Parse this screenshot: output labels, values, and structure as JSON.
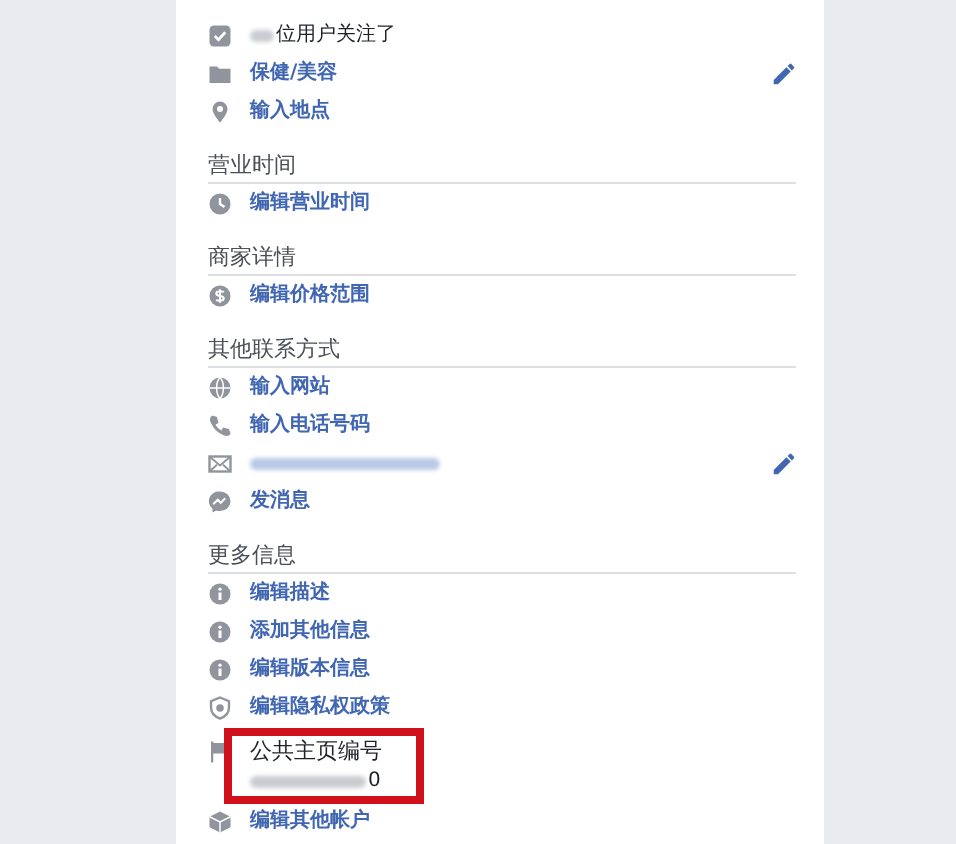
{
  "sections": [
    {
      "rows": [
        {
          "kind": "blurred",
          "text": "位用户关注了",
          "editable": false
        },
        {
          "kind": "link",
          "text": "保健/美容",
          "editable": true
        },
        {
          "kind": "link",
          "text": "输入地点",
          "editable": false
        }
      ]
    },
    {
      "heading": "营业时间",
      "rows": [
        {
          "kind": "link",
          "text": "编辑营业时间",
          "editable": false
        }
      ]
    },
    {
      "heading": "商家详情",
      "rows": [
        {
          "kind": "link",
          "text": "编辑价格范围",
          "editable": false
        }
      ]
    },
    {
      "heading": "其他联系方式",
      "rows": [
        {
          "kind": "link",
          "text": "输入网站",
          "editable": false
        },
        {
          "kind": "link",
          "text": "输入电话号码",
          "editable": false
        },
        {
          "kind": "hidden",
          "editable": true
        },
        {
          "kind": "link",
          "text": "发消息",
          "editable": false
        }
      ]
    },
    {
      "heading": "更多信息",
      "rows": [
        {
          "kind": "link",
          "text": "编辑描述",
          "editable": false
        },
        {
          "kind": "link",
          "text": "添加其他信息",
          "editable": false
        },
        {
          "kind": "link",
          "text": "编辑版本信息",
          "editable": false
        },
        {
          "kind": "link",
          "text": "编辑隐私权政策",
          "editable": false
        },
        {
          "kind": "id",
          "label": "公共主页编号",
          "value": "0",
          "editable": false
        },
        {
          "kind": "link",
          "text": "编辑其他帐户",
          "editable": false
        }
      ]
    }
  ],
  "highlight": {
    "kind": "box"
  }
}
